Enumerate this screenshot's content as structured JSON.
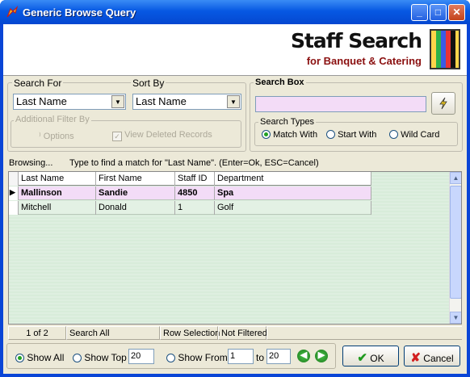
{
  "window": {
    "title": "Generic Browse Query",
    "minimize": "_",
    "maximize": "□",
    "close": "✕"
  },
  "banner": {
    "title": "Staff Search",
    "subtitle": "for Banquet & Catering"
  },
  "search_for": {
    "label": "Search For",
    "value": "Last Name"
  },
  "sort_by": {
    "label": "Sort By",
    "value": "Last Name"
  },
  "additional_filter": {
    "label": "Additional Filter By",
    "options_label": "Options",
    "view_deleted_label": "View Deleted Records",
    "view_deleted_checked": true
  },
  "search_box": {
    "label": "Search Box",
    "value": ""
  },
  "search_types": {
    "label": "Search Types",
    "options": [
      "Match With",
      "Start With",
      "Wild Card"
    ],
    "selected": "Match With"
  },
  "browse_status": {
    "mode": "Browsing...",
    "hint": "Type to find a match for \"Last Name\". (Enter=Ok, ESC=Cancel)"
  },
  "grid": {
    "columns": [
      "Last Name",
      "First Name",
      "Staff ID",
      "Department"
    ],
    "rows": [
      {
        "last": "Mallinson",
        "first": "Sandie",
        "id": "4850",
        "dept": "Spa",
        "selected": true
      },
      {
        "last": "Mitchell",
        "first": "Donald",
        "id": "1",
        "dept": "Golf",
        "selected": false
      }
    ]
  },
  "status_bar": {
    "position": "1 of 2",
    "scope": "Search All",
    "selection_mode": "Row Selection",
    "filter_state": "Not Filtered"
  },
  "bottom": {
    "show_all_label": "Show All",
    "show_top_label": "Show Top",
    "show_top_value": "20",
    "show_from_label": "Show From",
    "from_value": "1",
    "to_label": "to",
    "to_value": "20",
    "selected": "Show All"
  },
  "actions": {
    "ok_label": "OK",
    "cancel_label": "Cancel"
  },
  "colors": {
    "titlebar": "#0758e3",
    "selected_row": "#f3dcf7",
    "grid_background": "#d8ecda",
    "banner_subtitle": "#8b1010"
  }
}
